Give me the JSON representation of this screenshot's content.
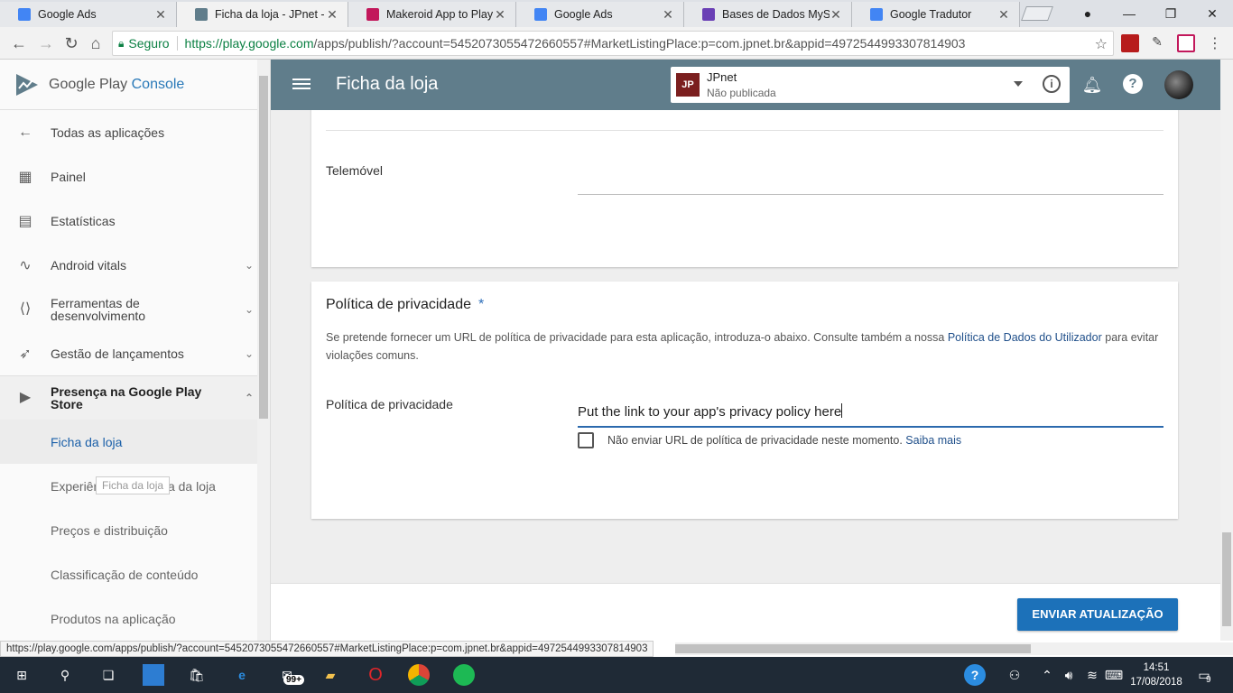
{
  "browser": {
    "tabs": [
      {
        "title": "Google Ads",
        "color": "#4285f4",
        "active": false
      },
      {
        "title": "Ficha da loja - JPnet - G",
        "color": "#607d8b",
        "active": true
      },
      {
        "title": "Makeroid App to Play St",
        "color": "#c2185b",
        "active": false
      },
      {
        "title": "Google Ads",
        "color": "#4285f4",
        "active": false
      },
      {
        "title": "Bases de Dados MySQL",
        "color": "#6a3fb5",
        "active": false
      },
      {
        "title": "Google Tradutor",
        "color": "#4285f4",
        "active": false
      }
    ],
    "secure_label": "Seguro",
    "url_host": "https://play.google.com",
    "url_rest": "/apps/publish/?account=5452073055472660557#MarketListingPlace:p=com.jpnet.br&appid=4972544993307814903"
  },
  "sidebar": {
    "logo_google": "Google Play",
    "logo_console": "Console",
    "items": [
      {
        "label": "Todas as aplicações",
        "icon": "arrow-back-icon"
      },
      {
        "label": "Painel",
        "icon": "dashboard-icon"
      },
      {
        "label": "Estatísticas",
        "icon": "bar-chart-icon"
      },
      {
        "label": "Android vitals",
        "icon": "pulse-icon"
      },
      {
        "label": "Ferramentas de desenvolvimento",
        "icon": "dev-tools-icon"
      },
      {
        "label": "Gestão de lançamentos",
        "icon": "rocket-icon"
      },
      {
        "label": "Presença na Google Play Store",
        "icon": "play-store-icon"
      },
      {
        "label": "Ficha da loja"
      },
      {
        "label": "Experiências da Ficha da loja"
      },
      {
        "label": "Preços e distribuição"
      },
      {
        "label": "Classificação de conteúdo"
      },
      {
        "label": "Produtos na aplicação"
      }
    ],
    "tooltip": "Ficha da loja"
  },
  "header": {
    "title": "Ficha da loja",
    "app_name": "JPnet",
    "app_status": "Não publicada",
    "app_initials": "JP"
  },
  "contact": {
    "phone_label": "Telemóvel"
  },
  "privacy": {
    "title": "Política de privacidade",
    "required_mark": "*",
    "desc_before": "Se pretende fornecer um URL de política de privacidade para esta aplicação, introduza-o abaixo. Consulte também a nossa ",
    "desc_link": "Política de Dados do Utilizador",
    "desc_after": " para evitar violações comuns.",
    "field_label": "Política de privacidade",
    "field_value": "Put the link to your app's privacy policy here",
    "checkbox_label": "Não enviar URL de política de privacidade neste momento.",
    "learn_more": "Saiba mais"
  },
  "footer": {
    "send_button": "ENVIAR ATUALIZAÇÃO"
  },
  "status_url": "https://play.google.com/apps/publish/?account=5452073055472660557#MarketListingPlace:p=com.jpnet.br&appid=4972544993307814903",
  "taskbar": {
    "badge": "99+",
    "time": "14:51",
    "date": "17/08/2018",
    "notifications": "9"
  }
}
